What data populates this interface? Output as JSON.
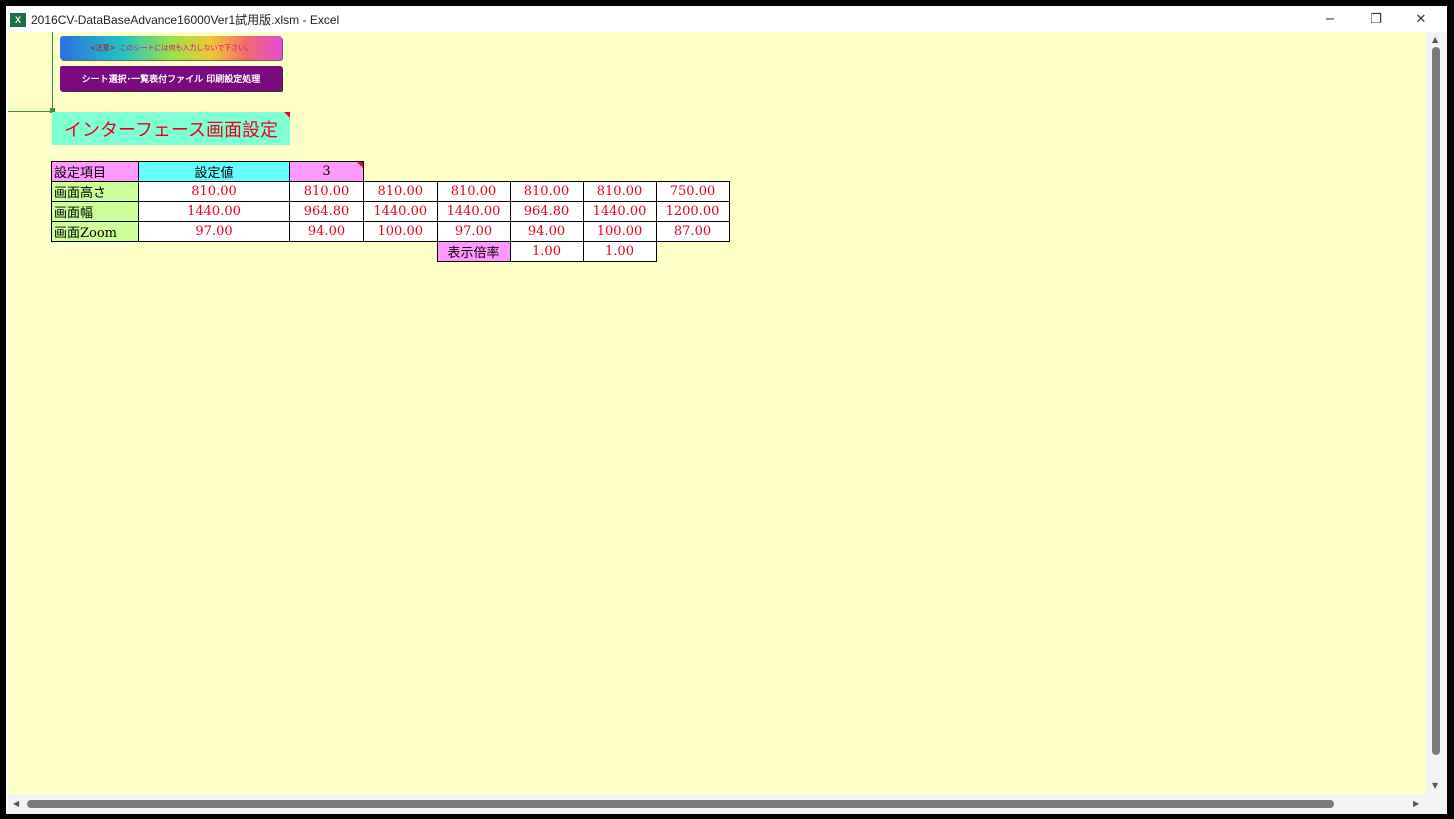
{
  "window": {
    "title": "2016CV-DataBaseAdvance16000Ver1試用版.xlsm - Excel",
    "app_icon_text": "X",
    "controls": {
      "minimize": "−",
      "restore": "❐",
      "close": "✕"
    }
  },
  "buttons": {
    "notice_tag": "<注意>",
    "notice_text": "このシートには何も入力しないで下さい。",
    "print_settings": "シート選択･一覧表付ファイル 印刷設定処理"
  },
  "heading": "インターフェース画面設定",
  "settings_table": {
    "header": {
      "item": "設定項目",
      "value": "設定値",
      "selected": "3"
    },
    "rows": [
      {
        "label": "画面高さ",
        "values": [
          "810.00",
          "810.00",
          "810.00",
          "810.00",
          "810.00",
          "810.00",
          "750.00"
        ]
      },
      {
        "label": "画面幅",
        "values": [
          "1440.00",
          "964.80",
          "1440.00",
          "1440.00",
          "964.80",
          "1440.00",
          "1200.00"
        ]
      },
      {
        "label": "画面Zoom",
        "values": [
          "97.00",
          "94.00",
          "100.00",
          "97.00",
          "94.00",
          "100.00",
          "87.00"
        ]
      }
    ],
    "ratio": {
      "label": "表示倍率",
      "values": [
        "1.00",
        "1.00"
      ]
    }
  },
  "colors": {
    "sheet_background": "#ffffc8",
    "value_text": "#e8001c",
    "row_header": "#ccff99",
    "col_header_pink": "#ff99ff",
    "col_header_cyan": "#66ffff",
    "heading_bg": "#7fffd4",
    "print_button": "#7a0a7e"
  }
}
